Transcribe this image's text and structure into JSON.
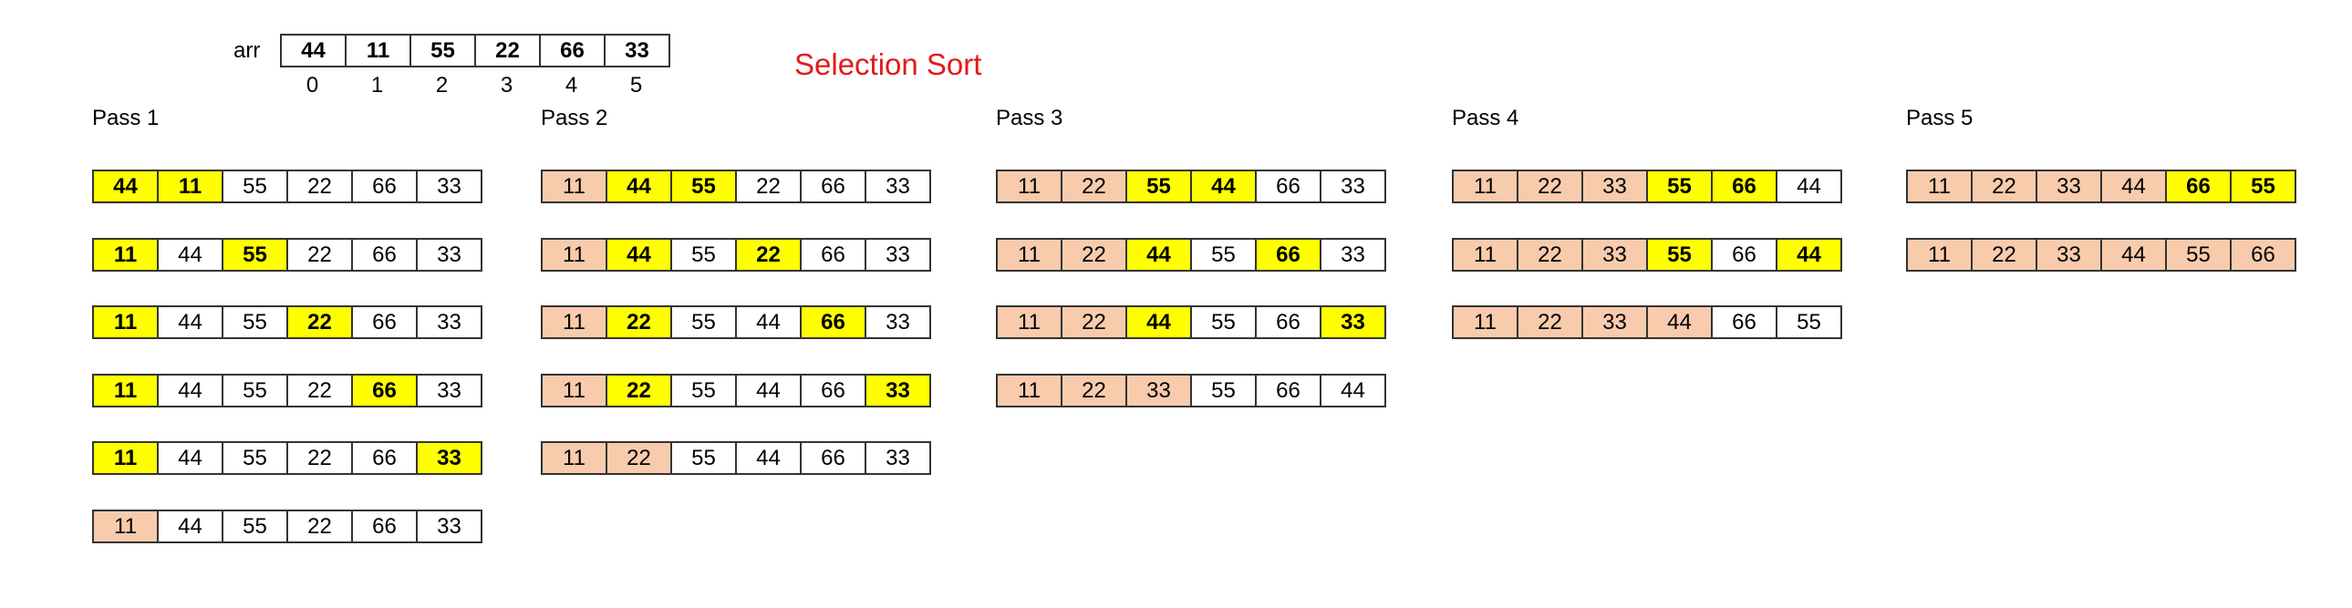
{
  "title": "Selection Sort",
  "array": {
    "label": "arr",
    "values": [
      "44",
      "11",
      "55",
      "22",
      "66",
      "33"
    ],
    "indices": [
      "0",
      "1",
      "2",
      "3",
      "4",
      "5"
    ]
  },
  "colors": {
    "highlight": "#ffff00",
    "sorted": "#f8cbad",
    "title": "#e11b1b"
  },
  "passes": [
    {
      "title": "Pass 1",
      "rows": [
        {
          "values": [
            "44",
            "11",
            "55",
            "22",
            "66",
            "33"
          ],
          "highlight": [
            0,
            1
          ],
          "sorted": []
        },
        {
          "values": [
            "11",
            "44",
            "55",
            "22",
            "66",
            "33"
          ],
          "highlight": [
            0,
            2
          ],
          "sorted": []
        },
        {
          "values": [
            "11",
            "44",
            "55",
            "22",
            "66",
            "33"
          ],
          "highlight": [
            0,
            3
          ],
          "sorted": []
        },
        {
          "values": [
            "11",
            "44",
            "55",
            "22",
            "66",
            "33"
          ],
          "highlight": [
            0,
            4
          ],
          "sorted": []
        },
        {
          "values": [
            "11",
            "44",
            "55",
            "22",
            "66",
            "33"
          ],
          "highlight": [
            0,
            5
          ],
          "sorted": []
        },
        {
          "values": [
            "11",
            "44",
            "55",
            "22",
            "66",
            "33"
          ],
          "highlight": [],
          "sorted": [
            0
          ]
        }
      ]
    },
    {
      "title": "Pass 2",
      "rows": [
        {
          "values": [
            "11",
            "44",
            "55",
            "22",
            "66",
            "33"
          ],
          "highlight": [
            1,
            2
          ],
          "sorted": [
            0
          ]
        },
        {
          "values": [
            "11",
            "44",
            "55",
            "22",
            "66",
            "33"
          ],
          "highlight": [
            1,
            3
          ],
          "sorted": [
            0
          ]
        },
        {
          "values": [
            "11",
            "22",
            "55",
            "44",
            "66",
            "33"
          ],
          "highlight": [
            1,
            4
          ],
          "sorted": [
            0
          ]
        },
        {
          "values": [
            "11",
            "22",
            "55",
            "44",
            "66",
            "33"
          ],
          "highlight": [
            1,
            5
          ],
          "sorted": [
            0
          ]
        },
        {
          "values": [
            "11",
            "22",
            "55",
            "44",
            "66",
            "33"
          ],
          "highlight": [],
          "sorted": [
            0,
            1
          ]
        }
      ]
    },
    {
      "title": "Pass 3",
      "rows": [
        {
          "values": [
            "11",
            "22",
            "55",
            "44",
            "66",
            "33"
          ],
          "highlight": [
            2,
            3
          ],
          "sorted": [
            0,
            1
          ]
        },
        {
          "values": [
            "11",
            "22",
            "44",
            "55",
            "66",
            "33"
          ],
          "highlight": [
            2,
            4
          ],
          "sorted": [
            0,
            1
          ]
        },
        {
          "values": [
            "11",
            "22",
            "44",
            "55",
            "66",
            "33"
          ],
          "highlight": [
            2,
            5
          ],
          "sorted": [
            0,
            1
          ]
        },
        {
          "values": [
            "11",
            "22",
            "33",
            "55",
            "66",
            "44"
          ],
          "highlight": [],
          "sorted": [
            0,
            1,
            2
          ]
        }
      ]
    },
    {
      "title": "Pass 4",
      "rows": [
        {
          "values": [
            "11",
            "22",
            "33",
            "55",
            "66",
            "44"
          ],
          "highlight": [
            3,
            4
          ],
          "sorted": [
            0,
            1,
            2
          ]
        },
        {
          "values": [
            "11",
            "22",
            "33",
            "55",
            "66",
            "44"
          ],
          "highlight": [
            3,
            5
          ],
          "sorted": [
            0,
            1,
            2
          ]
        },
        {
          "values": [
            "11",
            "22",
            "33",
            "44",
            "66",
            "55"
          ],
          "highlight": [],
          "sorted": [
            0,
            1,
            2,
            3
          ]
        }
      ]
    },
    {
      "title": "Pass 5",
      "rows": [
        {
          "values": [
            "11",
            "22",
            "33",
            "44",
            "66",
            "55"
          ],
          "highlight": [
            4,
            5
          ],
          "sorted": [
            0,
            1,
            2,
            3
          ]
        },
        {
          "values": [
            "11",
            "22",
            "33",
            "44",
            "55",
            "66"
          ],
          "highlight": [],
          "sorted": [
            0,
            1,
            2,
            3,
            4,
            5
          ]
        }
      ]
    }
  ]
}
